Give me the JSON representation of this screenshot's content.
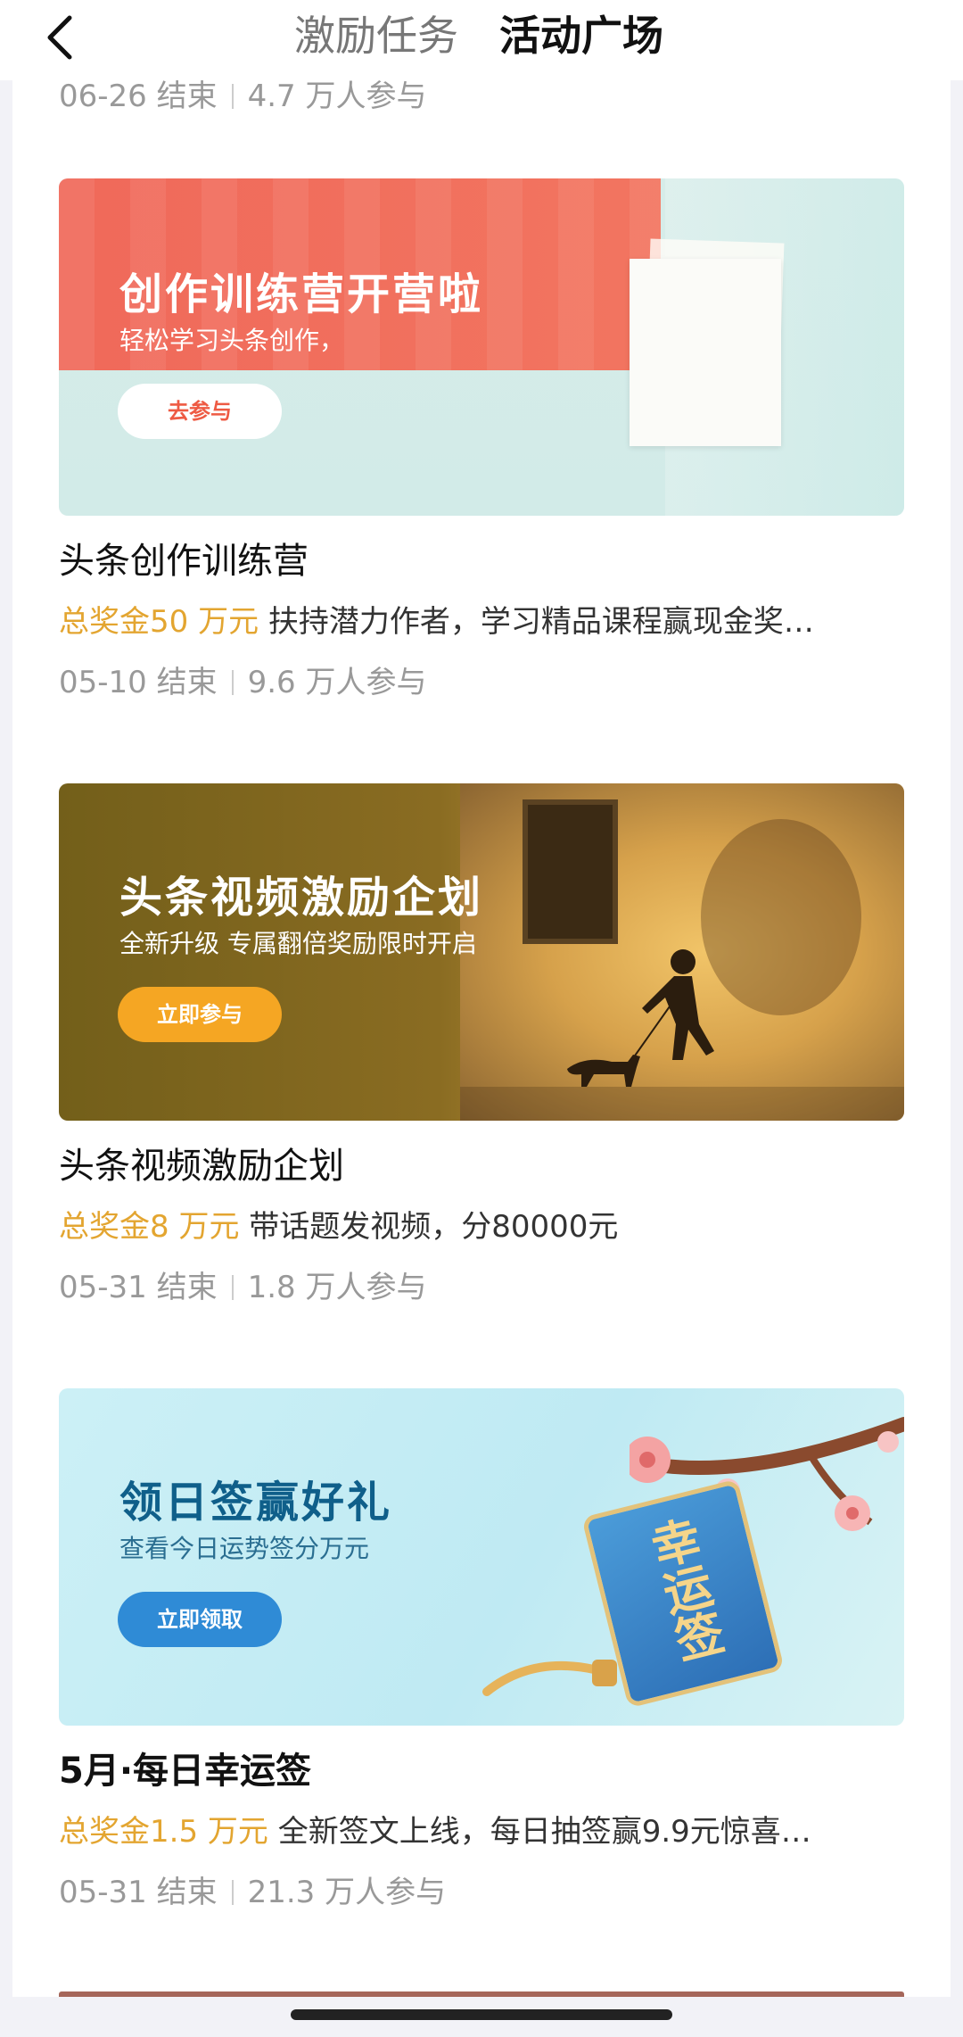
{
  "header": {
    "tab_inactive": "激励任务",
    "tab_active": "活动广场"
  },
  "partial_item": {
    "end": "06-26 结束",
    "participants": "4.7 万人参与"
  },
  "items": [
    {
      "banner_title": "创作训练营开营啦",
      "banner_sub": "轻松学习头条创作，",
      "banner_button": "去参与",
      "title": "头条创作训练营",
      "reward": "总奖金50 万元",
      "desc": " 扶持潜力作者，学习精品课程赢现金奖…",
      "end": "05-10 结束",
      "participants": "9.6 万人参与"
    },
    {
      "banner_title": "头条视频激励企划",
      "banner_sub": "全新升级 专属翻倍奖励限时开启",
      "banner_button": "立即参与",
      "title": "头条视频激励企划",
      "reward": "总奖金8 万元",
      "desc": " 带话题发视频，分80000元",
      "end": "05-31 结束",
      "participants": "1.8 万人参与"
    },
    {
      "banner_title": "领日签赢好礼",
      "banner_sub": "查看今日运势签分万元",
      "banner_button": "立即领取",
      "tag_text": "幸运签",
      "title": "5月·每日幸运签",
      "reward": "总奖金1.5 万元",
      "desc": " 全新签文上线，每日抽签赢9.9元惊喜…",
      "end": "05-31 结束",
      "participants": "21.3 万人参与"
    }
  ],
  "colors": {
    "reward": "#e3a530",
    "meta": "#999999"
  }
}
